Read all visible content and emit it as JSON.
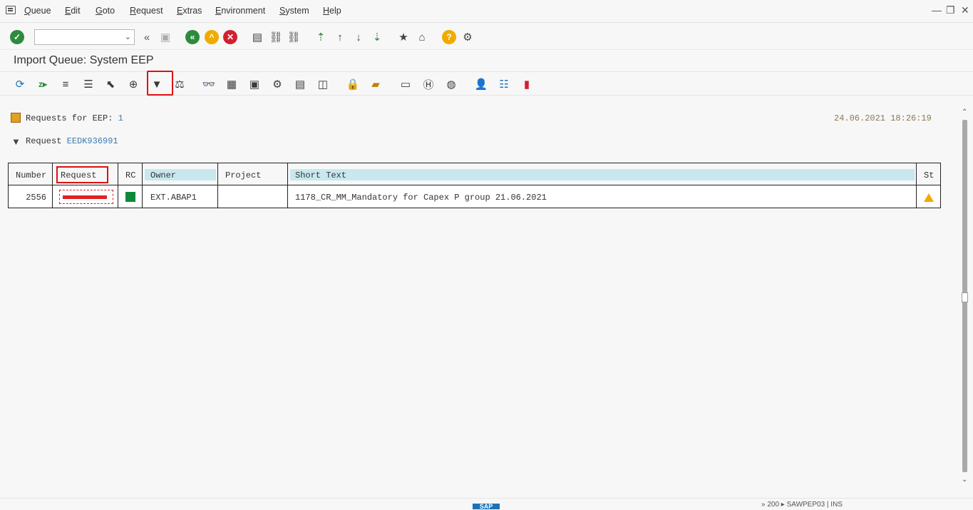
{
  "menu": {
    "items": [
      "Queue",
      "Edit",
      "Goto",
      "Request",
      "Extras",
      "Environment",
      "System",
      "Help"
    ]
  },
  "window_controls": [
    "—",
    "❐",
    "✕"
  ],
  "command_field": {
    "value": ""
  },
  "title": "Import Queue: System EEP",
  "info": {
    "requests_label": "Requests for EEP:",
    "requests_count": "1",
    "request_label": "Request",
    "request_value": "EEDK936991",
    "timestamp": "24.06.2021 18:26:19"
  },
  "table": {
    "headers": [
      "Number",
      "Request",
      "RC",
      "Owner",
      "Project",
      "Short Text",
      "St"
    ],
    "rows": [
      {
        "number": "2556",
        "request": "",
        "rc": "",
        "owner": "EXT.ABAP1",
        "project": "",
        "short_text": "1178_CR_MM_Mandatory for Capex P group 21.06.2021",
        "st": ""
      }
    ]
  },
  "status": {
    "sap": "SAP",
    "right": "» 200 ▸ SAWPEP03 | INS"
  },
  "colors": {
    "accent_green": "#2e8b3d",
    "amber": "#f0ab00",
    "highlight_red": "#e01010",
    "header_bar": "#c8e8ee"
  }
}
